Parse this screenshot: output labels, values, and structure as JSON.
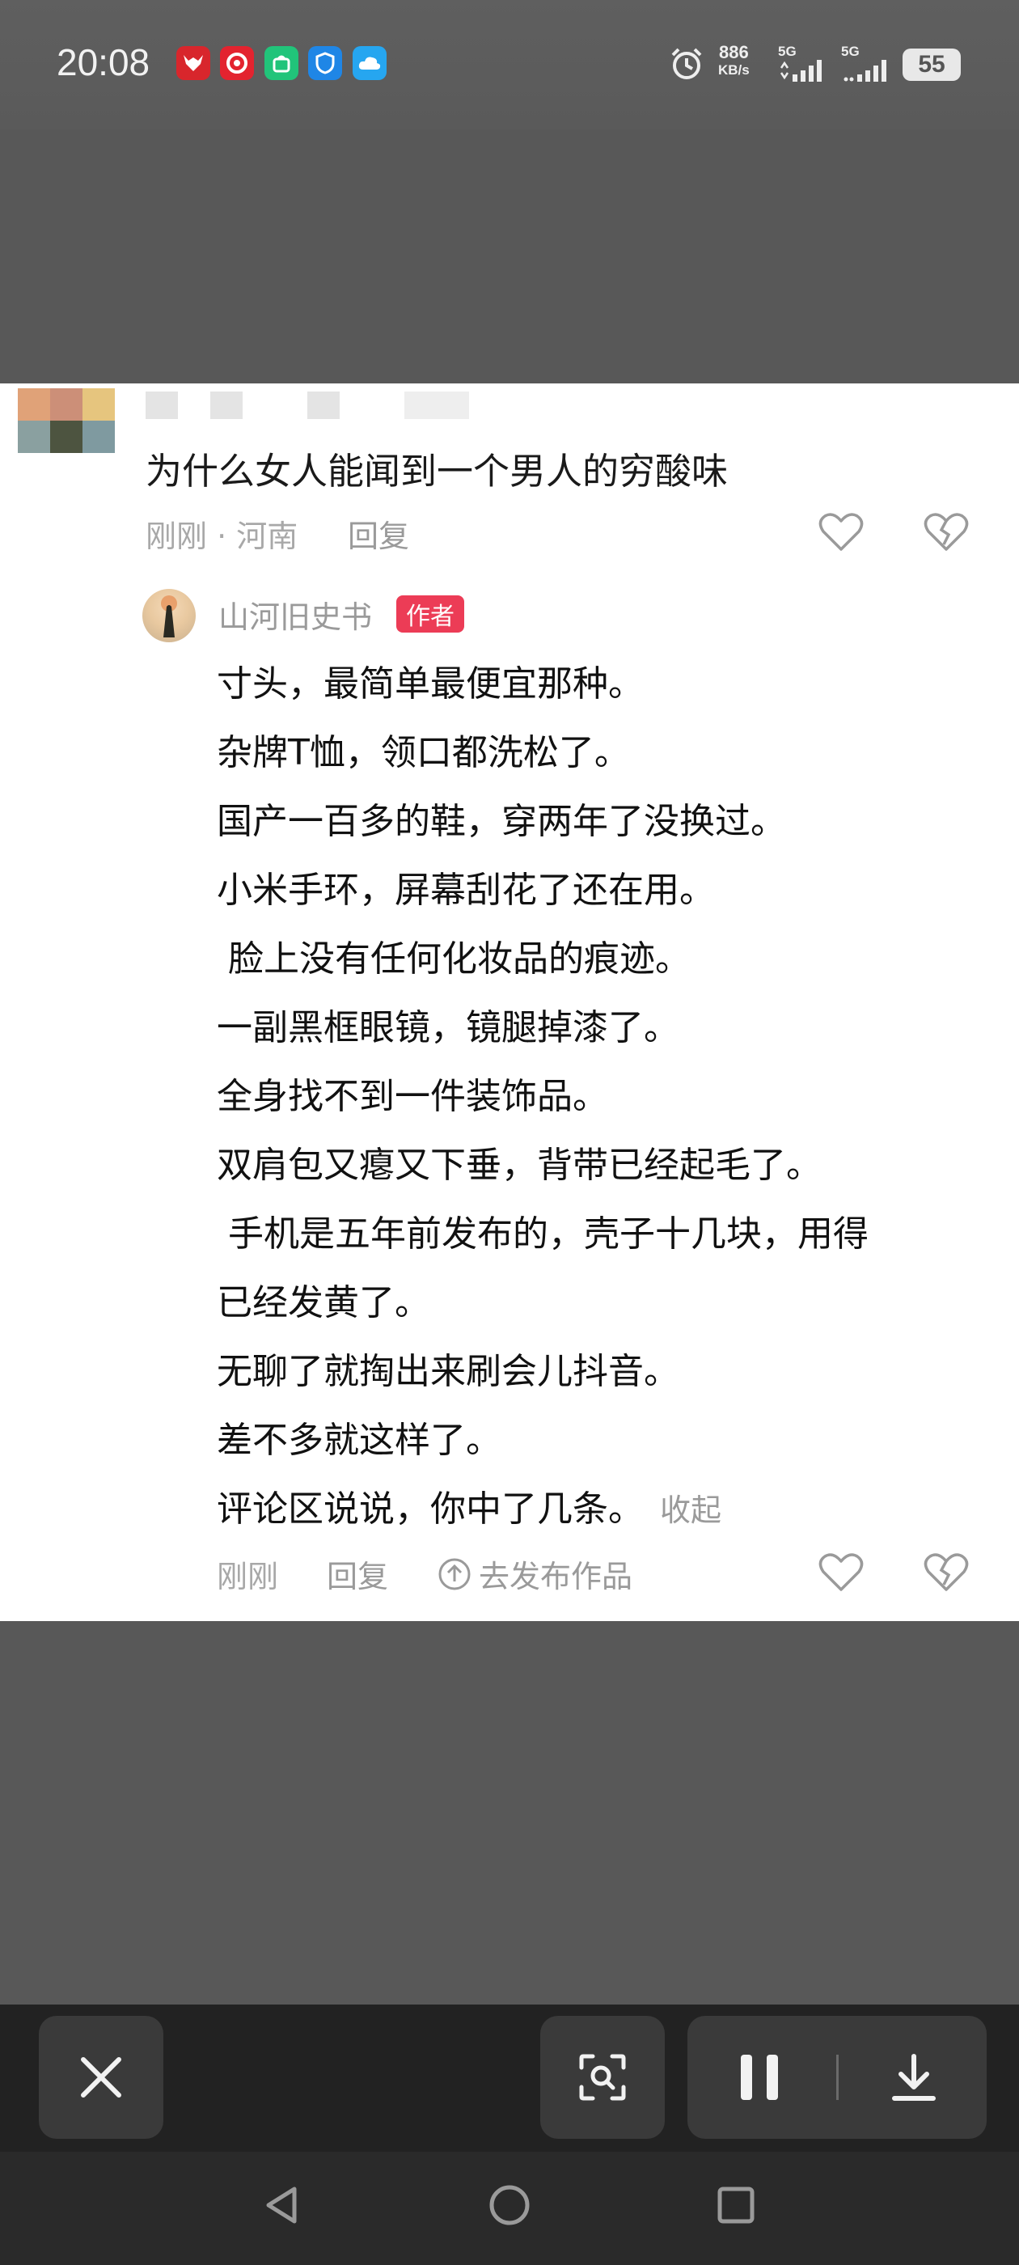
{
  "status_bar": {
    "time": "20:08",
    "net_speed_value": "886",
    "net_speed_unit": "KB/s",
    "signal_1": "5G",
    "signal_2": "5G",
    "battery": "55",
    "app_icons": [
      "app-icon-red-bull",
      "app-icon-red-target",
      "app-icon-green-bag",
      "app-icon-blue-shield",
      "app-icon-blue-cloud"
    ]
  },
  "comment": {
    "question": "为什么女人能闻到一个男人的穷酸味",
    "time_location": "刚刚 · 河南",
    "reply_label": "回复"
  },
  "reply": {
    "author_name": "山河旧史书",
    "author_badge": "作者",
    "lines": [
      "寸头，最简单最便宜那种。",
      "杂牌T恤，领口都洗松了。",
      "国产一百多的鞋，穿两年了没换过。",
      "小米手环，屏幕刮花了还在用。",
      " 脸上没有任何化妆品的痕迹。",
      "一副黑框眼镜，镜腿掉漆了。",
      "全身找不到一件装饰品。",
      "双肩包又瘪又下垂，背带已经起毛了。",
      " 手机是五年前发布的，壳子十几块，用得",
      "已经发黄了。",
      "无聊了就掏出来刷会儿抖音。",
      "差不多就这样了。",
      "评论区说说，你中了几条。"
    ],
    "collapse_label": "收起",
    "time": "刚刚",
    "reply_label": "回复",
    "publish_label": "去发布作品"
  },
  "controls": {
    "close": "close-icon",
    "scan": "scan-icon",
    "pause": "pause-icon",
    "download": "download-icon"
  },
  "colors": {
    "badge": "#ec3c56",
    "overlay": "#585858"
  }
}
